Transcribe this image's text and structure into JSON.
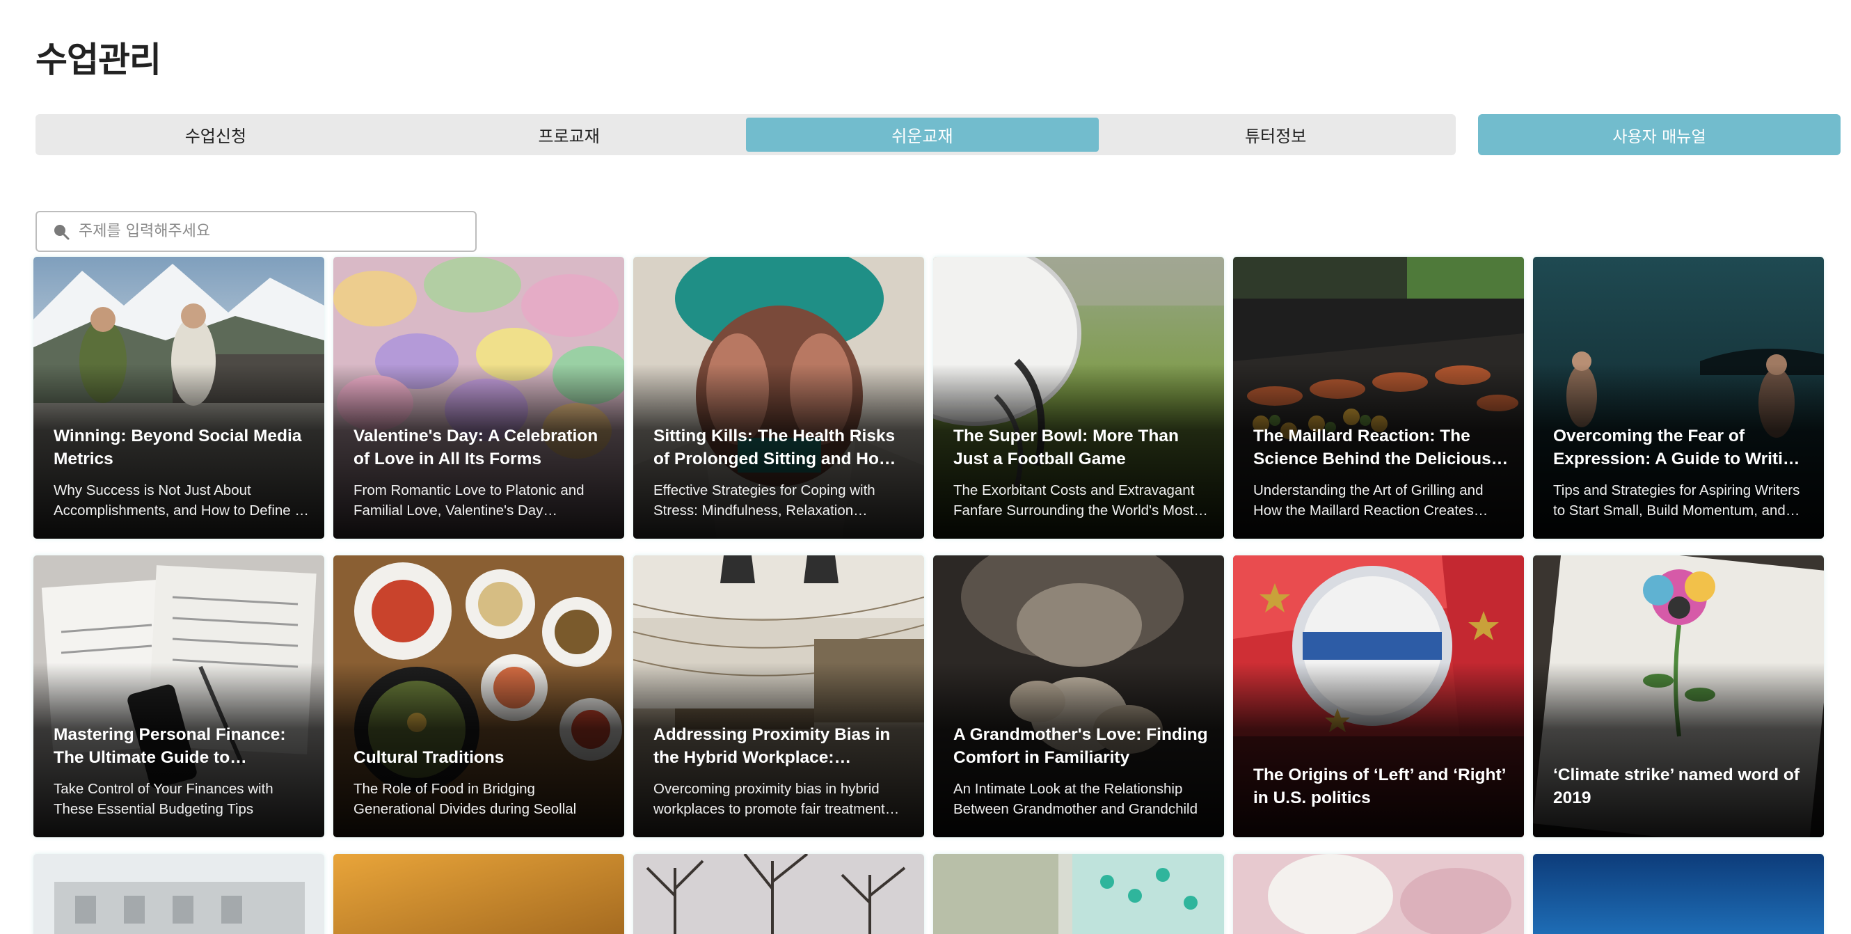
{
  "page": {
    "title": "수업관리"
  },
  "tabs": [
    {
      "label": "수업신청",
      "active": false
    },
    {
      "label": "프로교재",
      "active": false
    },
    {
      "label": "쉬운교재",
      "active": true
    },
    {
      "label": "튜터정보",
      "active": false
    }
  ],
  "manual_button": {
    "label": "사용자 매뉴얼"
  },
  "search": {
    "placeholder": "주제를 입력해주세요",
    "value": ""
  },
  "colors": {
    "accent": "#72bccd",
    "tab_bg": "#e9e9e9"
  },
  "cards": [
    {
      "title": "Winning: Beyond Social Media Metrics",
      "subtitle": "Why Success is Not Just About Accomplishments, and How to Define …"
    },
    {
      "title": "Valentine's Day: A Celebration of Love in All Its Forms",
      "subtitle": "From Romantic Love to Platonic and Familial Love, Valentine's Day Remind…"
    },
    {
      "title": "Sitting Kills: The Health Risks of Prolonged Sitting and How to…",
      "subtitle": "Effective Strategies for Coping with Stress: Mindfulness, Relaxation…"
    },
    {
      "title": "The Super Bowl: More Than Just a Football Game",
      "subtitle": "The Exorbitant Costs and Extravagant Fanfare Surrounding the World's Most…"
    },
    {
      "title": "The Maillard Reaction: The Science Behind the Delicious…",
      "subtitle": "Understanding the Art of Grilling and How the Maillard Reaction Creates…"
    },
    {
      "title": "Overcoming the Fear of Expression: A Guide to Writing f…",
      "subtitle": "Tips and Strategies for Aspiring Writers to Start Small, Build Momentum, and…"
    },
    {
      "title": "Mastering Personal Finance: The Ultimate Guide to Budgeting",
      "subtitle": "Take Control of Your Finances with These Essential Budgeting Tips"
    },
    {
      "title": "Cultural Traditions",
      "subtitle": "The Role of Food in Bridging Generational Divides during Seollal"
    },
    {
      "title": "Addressing Proximity Bias in the Hybrid Workplace: Strategies f…",
      "subtitle": "Overcoming proximity bias in hybrid workplaces to promote fair treatment…"
    },
    {
      "title": "A Grandmother's Love: Finding Comfort in Familiarity",
      "subtitle": "An Intimate Look at the Relationship Between Grandmother and Grandchild"
    },
    {
      "title": "The Origins of ‘Left’ and ‘Right’ in U.S. politics",
      "subtitle": ""
    },
    {
      "title": "‘Climate strike’ named word of 2019",
      "subtitle": ""
    }
  ]
}
